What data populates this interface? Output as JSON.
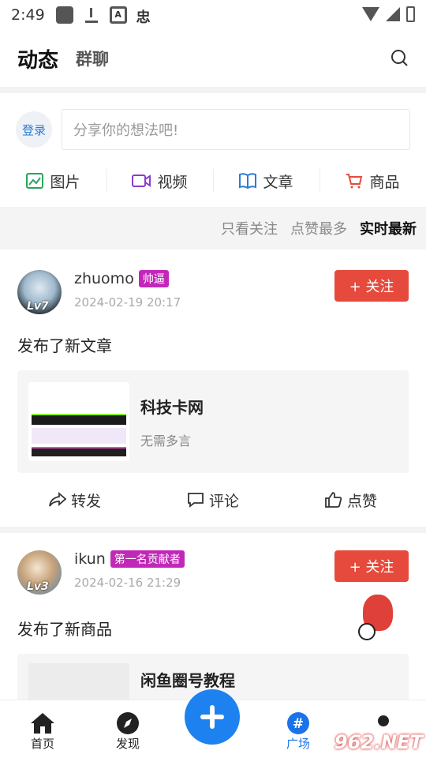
{
  "status_bar": {
    "time": "2:49"
  },
  "header": {
    "tab_active": "动态",
    "tab_other": "群聊"
  },
  "composer": {
    "login_label": "登录",
    "placeholder": "分享你的想法吧!"
  },
  "categories": [
    {
      "label": "图片",
      "icon": "image-icon",
      "color": "#2aa55a"
    },
    {
      "label": "视频",
      "icon": "video-icon",
      "color": "#8a3bd1"
    },
    {
      "label": "文章",
      "icon": "book-icon",
      "color": "#2a7bd8"
    },
    {
      "label": "商品",
      "icon": "cart-icon",
      "color": "#e64a3c"
    }
  ],
  "filters": {
    "follow_only": "只看关注",
    "most_liked": "点赞最多",
    "latest": "实时最新"
  },
  "posts": [
    {
      "username": "zhuomo",
      "badge": "帅逼",
      "level": "Lv7",
      "date": "2024-02-19 20:17",
      "follow_label": "+ 关注",
      "text": "发布了新文章",
      "card_title": "科技卡网",
      "card_sub": "无需多言",
      "repost": "转发",
      "comment": "评论",
      "like": "点赞"
    },
    {
      "username": "ikun",
      "badge": "第一名贡献者",
      "level": "Lv3",
      "date": "2024-02-16 21:29",
      "follow_label": "+ 关注",
      "text": "发布了新商品",
      "card_title": "闲鱼圈号教程"
    }
  ],
  "tabbar": {
    "home": "首页",
    "discover": "发现",
    "square": "广场"
  },
  "colors": {
    "accent": "#1d82f0",
    "follow": "#e64a3c",
    "badge": "#c228b8"
  }
}
